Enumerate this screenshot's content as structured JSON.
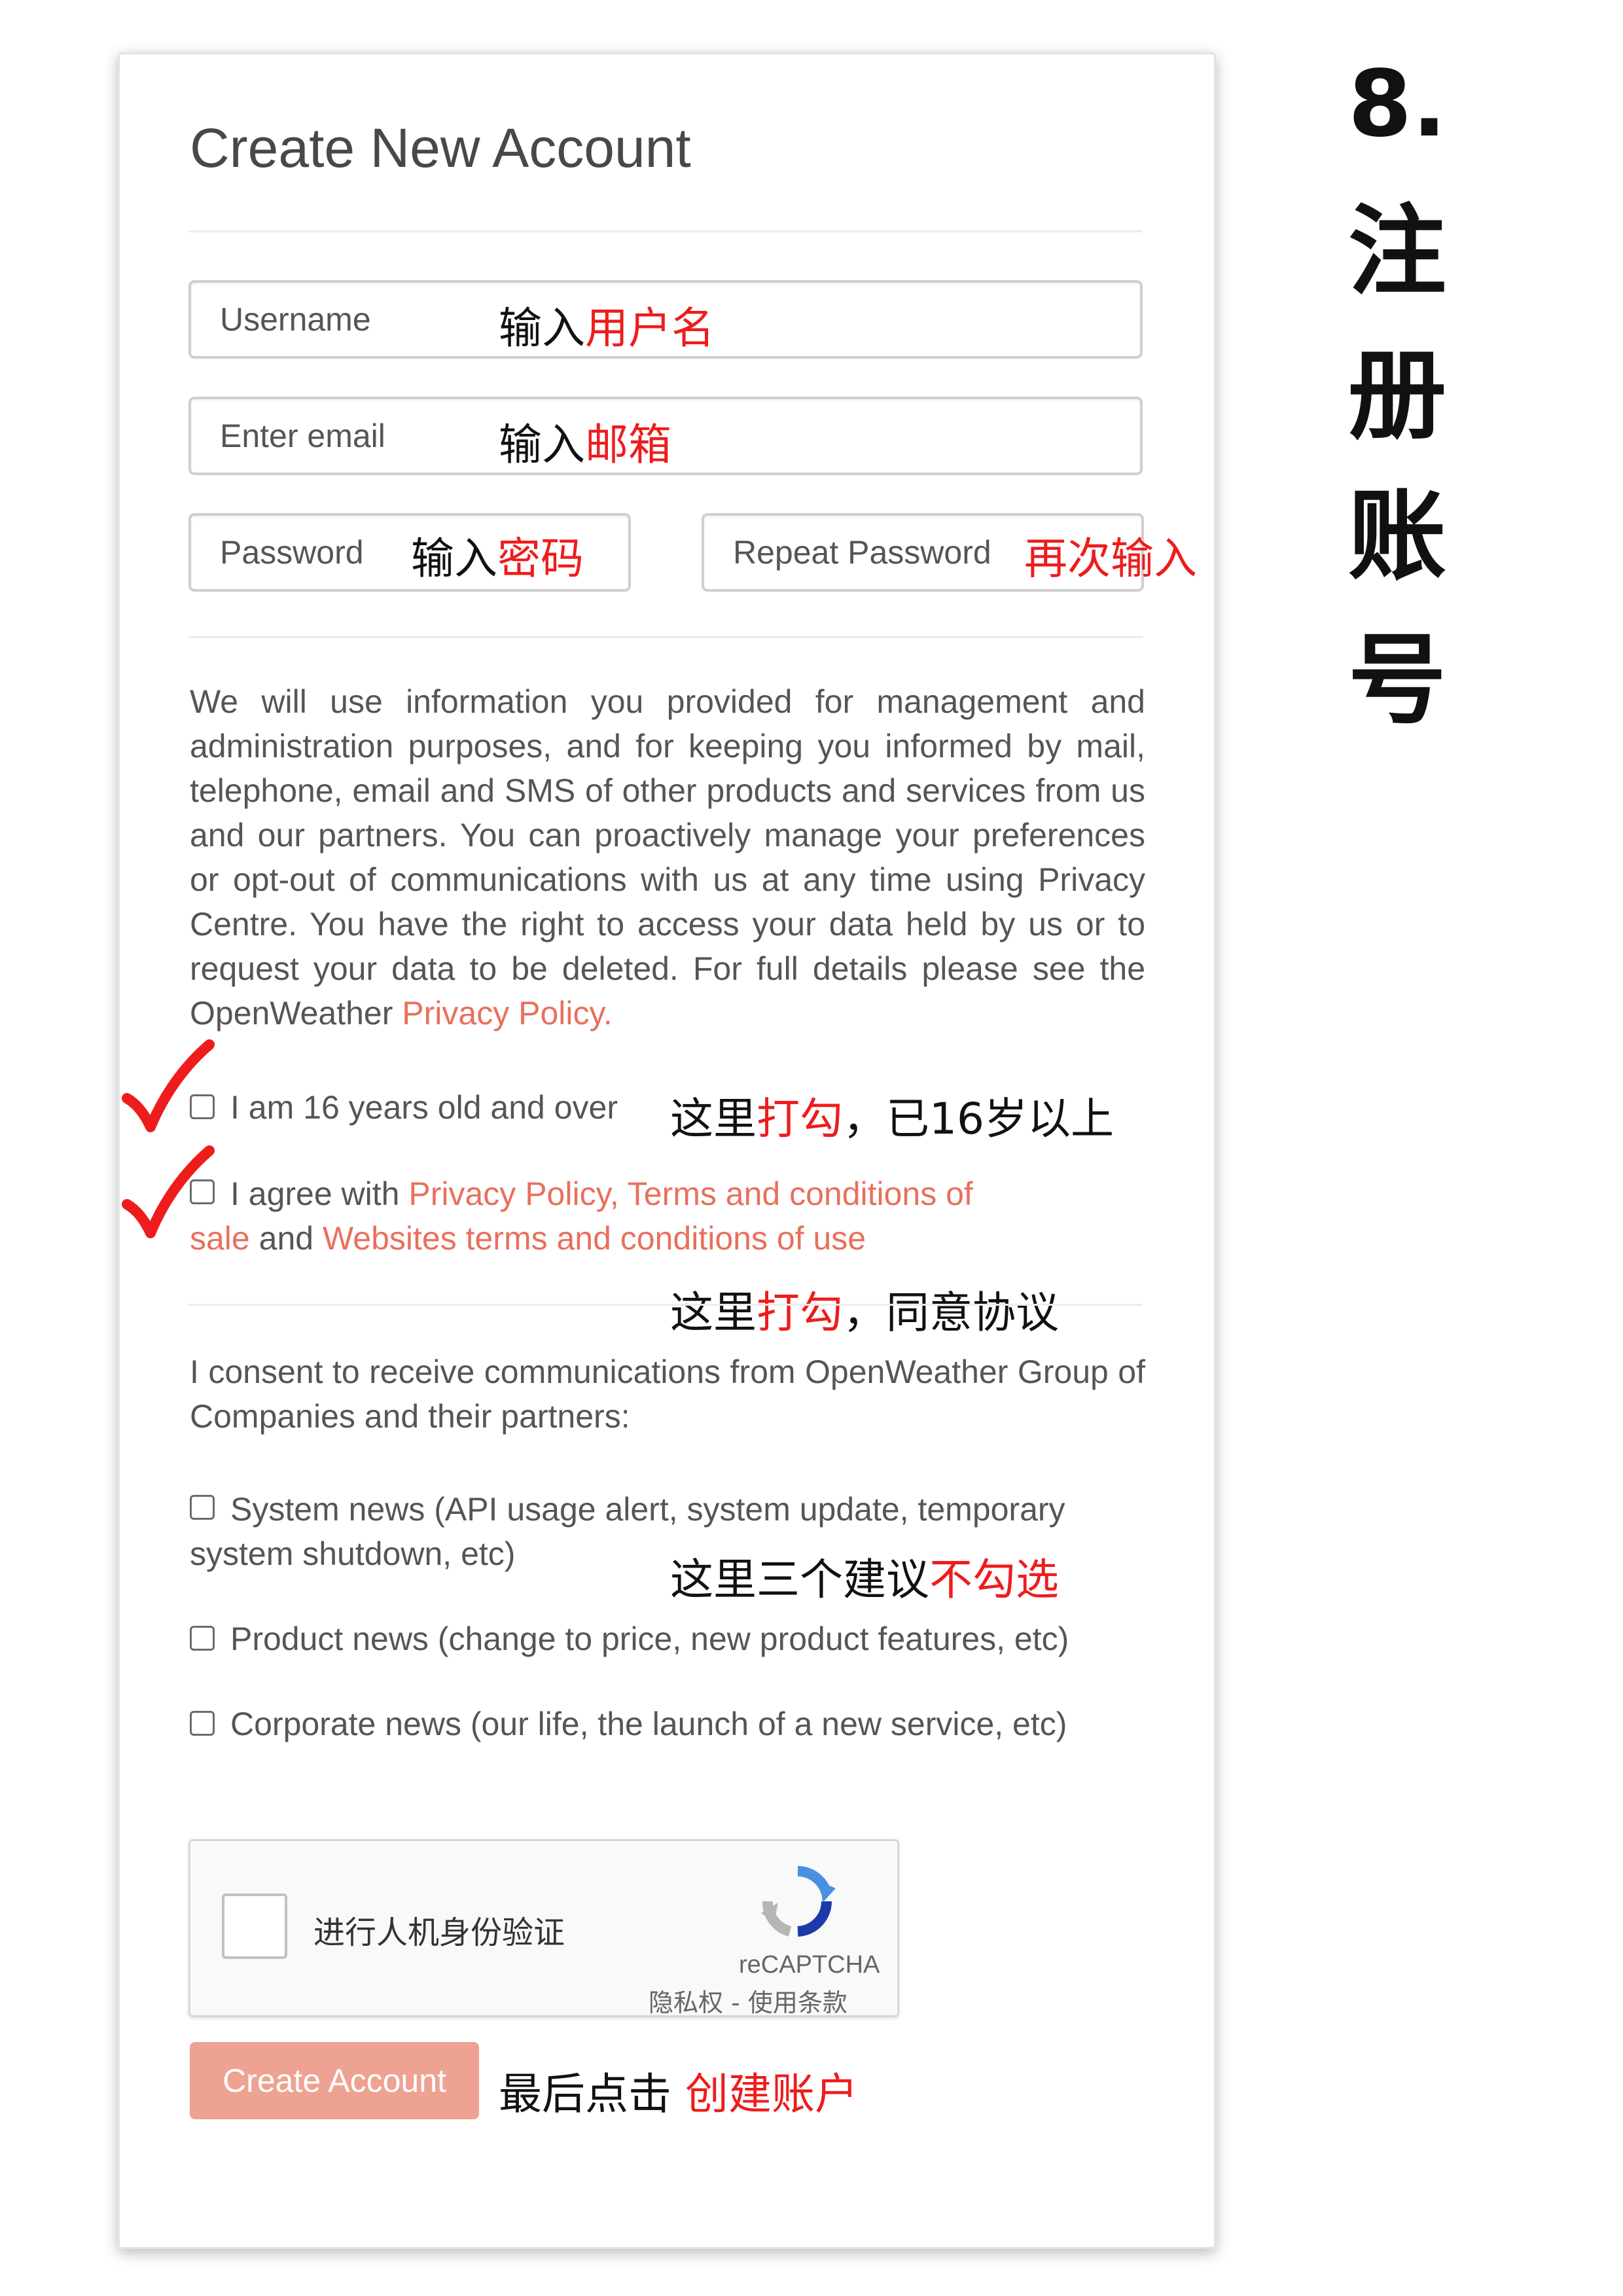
{
  "form": {
    "title": "Create New Account",
    "username_placeholder": "Username",
    "email_placeholder": "Enter email",
    "password_placeholder": "Password",
    "repeat_password_placeholder": "Repeat Password",
    "privacy_text": "We will use information you provided for management and administration purposes, and for keeping you informed by mail, telephone, email and SMS of other products and services from us and our partners. You can proactively manage your preferences or opt-out of communications with us at any time using Privacy Centre. You have the right to access your data held by us or to request your data to be deleted. For full details please see the OpenWeather",
    "privacy_link": "Privacy Policy",
    "privacy_end": ".",
    "age_label": "I am 16 years old and over",
    "agree_prefix": "I agree with",
    "agree_privacy_link": "Privacy Policy,",
    "agree_terms_link": "Terms and conditions of sale",
    "agree_and": "and",
    "agree_websites_link": "Websites terms and conditions of use",
    "consent_text": "I consent to receive communications from OpenWeather Group of Companies and their partners:",
    "system_news": "System news (API usage alert, system update, temporary system shutdown, etc)",
    "product_news": "Product news (change to price, new product features, etc)",
    "corporate_news": "Corporate news (our life, the launch of a new service, etc)",
    "captcha": {
      "label": "进行人机身份验证",
      "brand": "reCAPTCHA",
      "links": "隐私权 - 使用条款"
    },
    "submit_label": "Create Account"
  },
  "annotations": {
    "username_a": "输入",
    "username_b": "用户名",
    "email_a": "输入",
    "email_b": "邮箱",
    "password_a": "输入",
    "password_b": "密码",
    "repeat": "再次输入",
    "age_a": "这里",
    "age_b": "打勾",
    "age_c": "，已16岁以上",
    "agree_a": "这里",
    "agree_b": "打勾",
    "agree_c": "，同意协议",
    "news_a": "这里三个建议",
    "news_b": "不勾选",
    "submit_a": "最后点击",
    "submit_b": "创建账户"
  },
  "side_title": {
    "step": "8.",
    "chars": [
      "注",
      "册",
      "账",
      "号"
    ]
  },
  "colors": {
    "annotation_red": "#ee1c1c",
    "link": "#e8705c",
    "button": "#eea292"
  }
}
